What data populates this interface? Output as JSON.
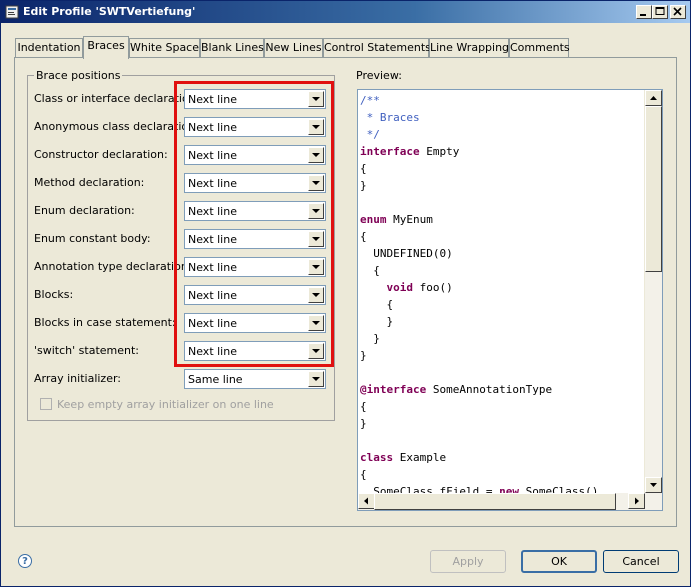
{
  "window": {
    "title": "Edit Profile 'SWTVertiefung'",
    "controls": [
      "minimize",
      "maximize",
      "close"
    ]
  },
  "tabs": [
    {
      "label": "Indentation",
      "active": false
    },
    {
      "label": "Braces",
      "active": true
    },
    {
      "label": "White Space",
      "active": false
    },
    {
      "label": "Blank Lines",
      "active": false
    },
    {
      "label": "New Lines",
      "active": false
    },
    {
      "label": "Control Statements",
      "active": false
    },
    {
      "label": "Line Wrapping",
      "active": false
    },
    {
      "label": "Comments",
      "active": false
    }
  ],
  "brace_positions": {
    "group_title": "Brace positions",
    "rows": [
      {
        "label": "Class or interface declaration:",
        "value": "Next line"
      },
      {
        "label": "Anonymous class declaration:",
        "value": "Next line"
      },
      {
        "label": "Constructor declaration:",
        "value": "Next line"
      },
      {
        "label": "Method declaration:",
        "value": "Next line"
      },
      {
        "label": "Enum declaration:",
        "value": "Next line"
      },
      {
        "label": "Enum constant body:",
        "value": "Next line"
      },
      {
        "label": "Annotation type declaration:",
        "value": "Next line"
      },
      {
        "label": "Blocks:",
        "value": "Next line"
      },
      {
        "label": "Blocks in case statement:",
        "value": "Next line"
      },
      {
        "label": "'switch' statement:",
        "value": "Next line"
      },
      {
        "label": "Array initializer:",
        "value": "Same line"
      }
    ],
    "keep_empty_label": "Keep empty array initializer on one line",
    "keep_empty_checked": false,
    "keep_empty_enabled": false
  },
  "preview": {
    "label": "Preview:",
    "lines": [
      [
        {
          "t": "/**",
          "c": "cm"
        }
      ],
      [
        {
          "t": " * Braces",
          "c": "cm"
        }
      ],
      [
        {
          "t": " */",
          "c": "cm"
        }
      ],
      [
        {
          "t": "interface",
          "c": "kw"
        },
        {
          "t": " Empty",
          "c": ""
        }
      ],
      [
        {
          "t": "{",
          "c": ""
        }
      ],
      [
        {
          "t": "}",
          "c": ""
        }
      ],
      [
        {
          "t": "",
          "c": ""
        }
      ],
      [
        {
          "t": "enum",
          "c": "kw"
        },
        {
          "t": " MyEnum",
          "c": ""
        }
      ],
      [
        {
          "t": "{",
          "c": ""
        }
      ],
      [
        {
          "t": "  UNDEFINED(0)",
          "c": ""
        }
      ],
      [
        {
          "t": "  {",
          "c": ""
        }
      ],
      [
        {
          "t": "    ",
          "c": ""
        },
        {
          "t": "void",
          "c": "kw"
        },
        {
          "t": " foo()",
          "c": ""
        }
      ],
      [
        {
          "t": "    {",
          "c": ""
        }
      ],
      [
        {
          "t": "    }",
          "c": ""
        }
      ],
      [
        {
          "t": "  }",
          "c": ""
        }
      ],
      [
        {
          "t": "}",
          "c": ""
        }
      ],
      [
        {
          "t": "",
          "c": ""
        }
      ],
      [
        {
          "t": "@interface",
          "c": "kw"
        },
        {
          "t": " SomeAnnotationType",
          "c": ""
        }
      ],
      [
        {
          "t": "{",
          "c": ""
        }
      ],
      [
        {
          "t": "}",
          "c": ""
        }
      ],
      [
        {
          "t": "",
          "c": ""
        }
      ],
      [
        {
          "t": "class",
          "c": "kw"
        },
        {
          "t": " Example",
          "c": ""
        }
      ],
      [
        {
          "t": "{",
          "c": ""
        }
      ],
      [
        {
          "t": "  SomeClass fField = ",
          "c": ""
        },
        {
          "t": "new",
          "c": "kw"
        },
        {
          "t": " SomeClass()",
          "c": ""
        }
      ]
    ]
  },
  "buttons": {
    "apply": "Apply",
    "ok": "OK",
    "cancel": "Cancel",
    "apply_enabled": false
  },
  "colors": {
    "highlight_border": "#e01010",
    "keyword": "#7f0055",
    "comment": "#3f5fbf",
    "titlebar": "#0a246a"
  }
}
